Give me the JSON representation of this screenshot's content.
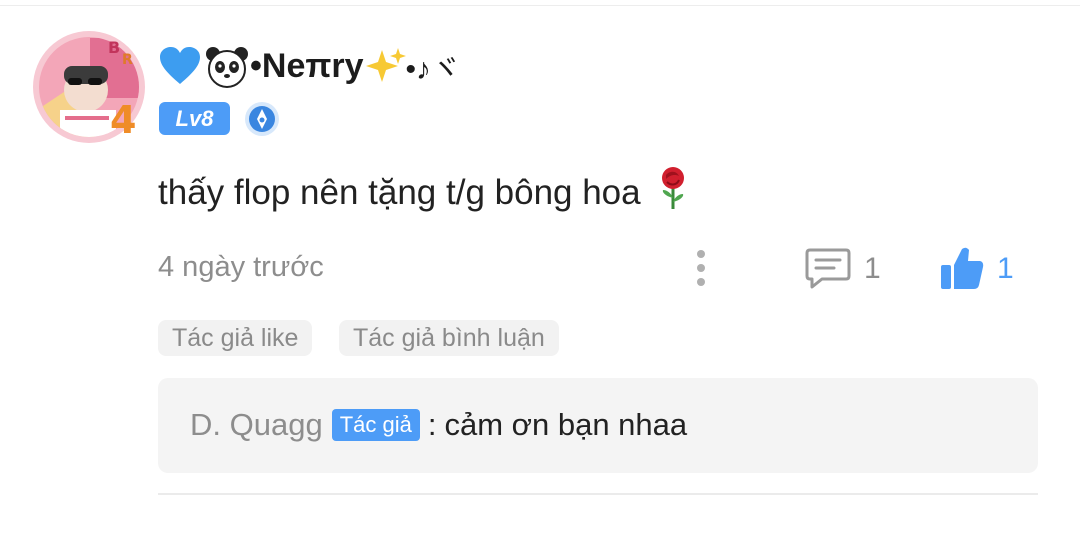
{
  "post": {
    "username": "•Neπry",
    "username_suffix": "•♪ヾ",
    "level": "Lv8",
    "comment_text": "thấy flop nên tặng t/g bông hoa",
    "timestamp": "4 ngày trước",
    "reply_count": "1",
    "like_count": "1",
    "avatar_badge_text": "4"
  },
  "tags": [
    "Tác giả like",
    "Tác giả bình luận"
  ],
  "reply": {
    "author": "D. Quagg",
    "author_badge": "Tác giả",
    "separator": ":",
    "text": "cảm ơn bạn nhaa"
  },
  "colors": {
    "accent": "#4d9cf7",
    "text_primary": "#222222",
    "text_secondary": "#8d8d8d",
    "tag_bg": "#f2f2f2",
    "reply_bg": "#f4f4f4"
  },
  "icons": [
    "blue-heart-icon",
    "panda-icon",
    "sparkles-icon",
    "medal-icon",
    "rose-icon",
    "more-icon",
    "reply-icon",
    "like-icon"
  ]
}
